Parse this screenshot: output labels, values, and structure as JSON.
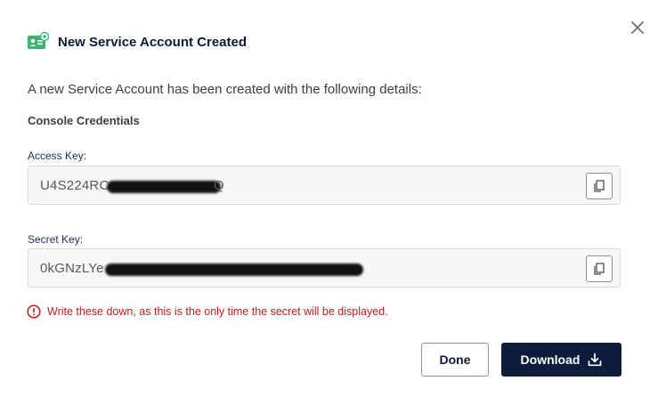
{
  "dialog": {
    "title": "New Service Account Created",
    "intro": "A new Service Account has been created with the following details:",
    "section_title": "Console Credentials"
  },
  "access_key": {
    "label": "Access Key:",
    "value_visible": "U4S224RC",
    "value_tail_visible": "Q"
  },
  "secret_key": {
    "label": "Secret Key:",
    "value_visible": "0kGNzLYe"
  },
  "warning": {
    "text": "Write these down, as this is the only time the secret will be displayed."
  },
  "buttons": {
    "done": "Done",
    "download": "Download"
  },
  "icons": {
    "header": "service-account-card-icon",
    "close": "close-icon",
    "copy": "copy-icon",
    "warning": "alert-circle-icon",
    "download": "download-icon"
  },
  "colors": {
    "header_icon": "#3cb371",
    "warning": "#c51b1b",
    "primary_button": "#0d1c3d",
    "title": "#0c1b33"
  }
}
